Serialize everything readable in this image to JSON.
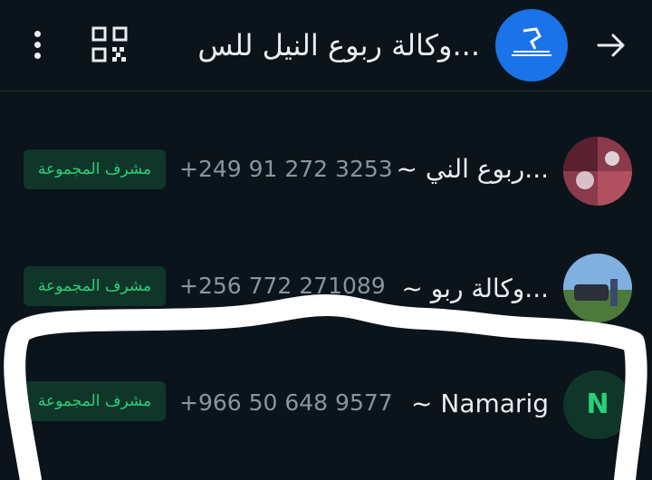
{
  "header": {
    "title": "وكالة ربوع النيل للس...",
    "icons": {
      "menu": "more-vert-icon",
      "qr": "qr-code-icon",
      "back": "arrow-forward-icon"
    }
  },
  "members": [
    {
      "name": "~ ربوع الني...",
      "phone": "+249 91 272 3253",
      "badge": "مشرف المجموعة"
    },
    {
      "name": "~ وكالة ربو...",
      "phone": "+256 772 271089",
      "badge": "مشرف المجموعة"
    },
    {
      "name": "~ Namarig",
      "phone": "+966 50 648 9577",
      "badge": "مشرف المجموعة",
      "avatar_letter": "N"
    }
  ],
  "colors": {
    "background": "#0b141a",
    "badge_bg": "#103629",
    "badge_text": "#29d07a",
    "phone_text": "#8696a0",
    "group_avatar": "#1a73e8",
    "annotation": "#ffffff"
  }
}
